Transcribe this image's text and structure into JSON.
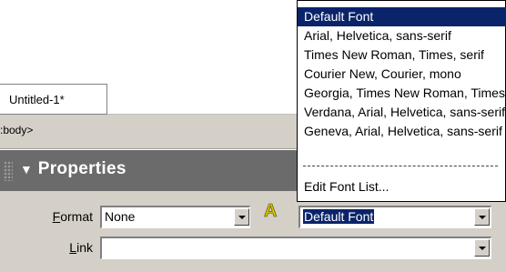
{
  "document": {
    "tab_title": "Untitled-1*",
    "breadcrumb": ":body>"
  },
  "properties": {
    "title": "Properties",
    "format_label": "Format",
    "format_value": "None",
    "font_value": "Default Font",
    "link_label": "Link",
    "link_value": ""
  },
  "font_menu": {
    "items": [
      "Default Font",
      "Arial, Helvetica, sans-serif",
      "Times New Roman, Times, serif",
      "Courier New, Courier, mono",
      "Georgia, Times New Roman, Times, serif",
      "Verdana, Arial, Helvetica, sans-serif",
      "Geneva, Arial, Helvetica, sans-serif"
    ],
    "edit_label": "Edit Font List..."
  },
  "colors": {
    "selection": "#0a246a",
    "panel": "#d4d0c8",
    "props_bar": "#6b6b6b"
  }
}
